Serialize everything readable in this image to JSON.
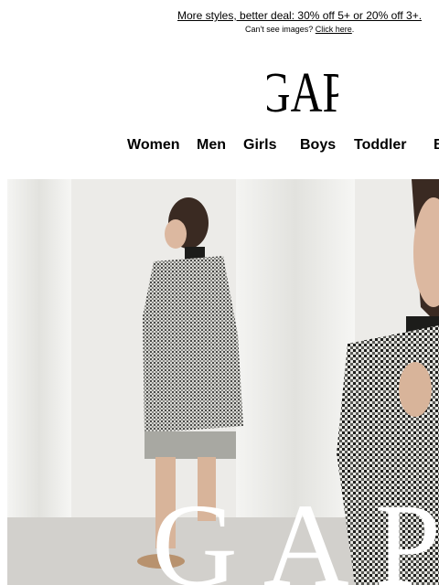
{
  "promo": {
    "text": "More styles, better deal: 30% off 5+ or 20% off 3+.",
    "cant_see": "Can't see images?",
    "click_here": "Click here",
    "period": "."
  },
  "logo": {
    "text": "GAP"
  },
  "nav": {
    "items": [
      {
        "label": "Women"
      },
      {
        "label": "Men"
      },
      {
        "label": "Girls"
      },
      {
        "label": "Boys"
      },
      {
        "label": "Toddler"
      },
      {
        "label": "B"
      }
    ]
  },
  "hero": {
    "overlay_text": "GAP"
  }
}
